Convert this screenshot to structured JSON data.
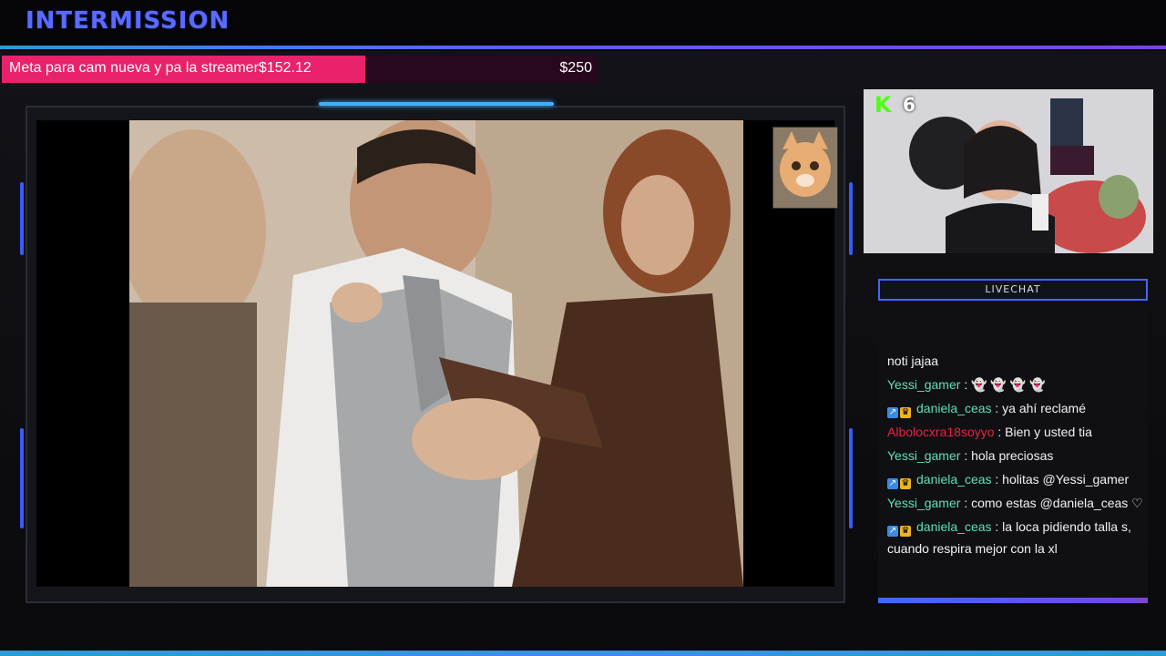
{
  "header": {
    "title": "INTERMISSION"
  },
  "goal": {
    "label": "Meta para cam nueva y pa la streamer",
    "current": "$152.12",
    "target": "$250",
    "progress": 0.61
  },
  "webcam": {
    "platform_icon": "kick-logo-icon",
    "viewers": "6"
  },
  "chat": {
    "header": "LIVECHAT",
    "messages": [
      {
        "user": "",
        "text": "noti jajaa",
        "color": "#f2f2f2",
        "badges": false
      },
      {
        "user": "Yessi_gamer",
        "text": ": 👻 👻 👻 👻",
        "color": "#5fe0b3",
        "badges": false
      },
      {
        "user": "daniela_ceas",
        "text": ": ya ahí reclamé",
        "color": "#5fe0b3",
        "badges": true
      },
      {
        "user": "Albolocxra18soyyo",
        "text": ": Bien y usted tia",
        "color": "#e8233b",
        "badges": false
      },
      {
        "user": "Yessi_gamer",
        "text": ": hola preciosas",
        "color": "#5fe0b3",
        "badges": false
      },
      {
        "user": "daniela_ceas",
        "text": ": holitas @Yessi_gamer",
        "color": "#5fe0b3",
        "badges": true
      },
      {
        "user": "Yessi_gamer",
        "text": ": como estas @daniela_ceas ♡",
        "color": "#5fe0b3",
        "badges": false
      },
      {
        "user": "daniela_ceas",
        "text": ": la loca pidiendo talla s, cuando respira mejor con la xl",
        "color": "#5fe0b3",
        "badges": true
      }
    ]
  },
  "colors": {
    "accent": "#5a6bff",
    "goal_fill": "#e8236b",
    "username_green": "#5fe0b3",
    "username_red": "#e8233b",
    "kick_green": "#53fc18"
  }
}
